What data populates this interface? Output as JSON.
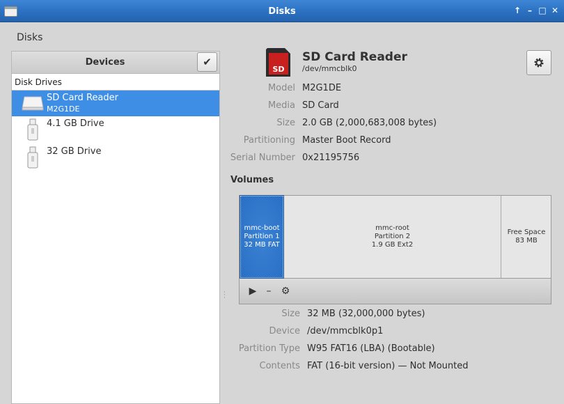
{
  "window": {
    "title": "Disks",
    "controls": {
      "up": "↑",
      "minimize": "–",
      "maximize": "□",
      "close": "✕"
    }
  },
  "breadcrumb": "Disks",
  "devices": {
    "header": "Devices",
    "check_icon": "✔",
    "group_label": "Disk Drives",
    "items": [
      {
        "name": "SD Card Reader",
        "sub": "M2G1DE",
        "icon": "drive-icon",
        "selected": true
      },
      {
        "name": "4.1 GB Drive",
        "sub": "",
        "icon": "usb-drive-icon",
        "selected": false
      },
      {
        "name": "32 GB Drive",
        "sub": "",
        "icon": "usb-drive-icon",
        "selected": false
      }
    ]
  },
  "disk": {
    "icon_text": "SD",
    "title": "SD Card Reader",
    "path": "/dev/mmcblk0",
    "fields": [
      {
        "key": "Model",
        "value": "M2G1DE"
      },
      {
        "key": "Media",
        "value": "SD Card"
      },
      {
        "key": "Size",
        "value": "2.0 GB (2,000,683,008 bytes)"
      },
      {
        "key": "Partitioning",
        "value": "Master Boot Record"
      },
      {
        "key": "Serial Number",
        "value": "0x21195756"
      }
    ]
  },
  "volumes": {
    "label": "Volumes",
    "partitions": [
      {
        "line1": "mmc-boot",
        "line2": "Partition 1",
        "line3": "32 MB FAT",
        "selected": true
      },
      {
        "line1": "mmc-root",
        "line2": "Partition 2",
        "line3": "1.9 GB Ext2",
        "selected": false
      },
      {
        "line1": "Free Space",
        "line2": "83 MB",
        "line3": "",
        "selected": false
      }
    ],
    "tools": {
      "mount": "▶",
      "delete": "–",
      "settings": "⚙"
    }
  },
  "partition": {
    "fields": [
      {
        "key": "Size",
        "value": "32 MB (32,000,000 bytes)"
      },
      {
        "key": "Device",
        "value": "/dev/mmcblk0p1"
      },
      {
        "key": "Partition Type",
        "value": "W95 FAT16 (LBA) (Bootable)"
      },
      {
        "key": "Contents",
        "value": "FAT (16-bit version) — Not Mounted"
      }
    ]
  },
  "colors": {
    "accent": "#3d8ee4",
    "titlebar": "#2a6fbf",
    "selected_volume": "#2a6fc4"
  }
}
